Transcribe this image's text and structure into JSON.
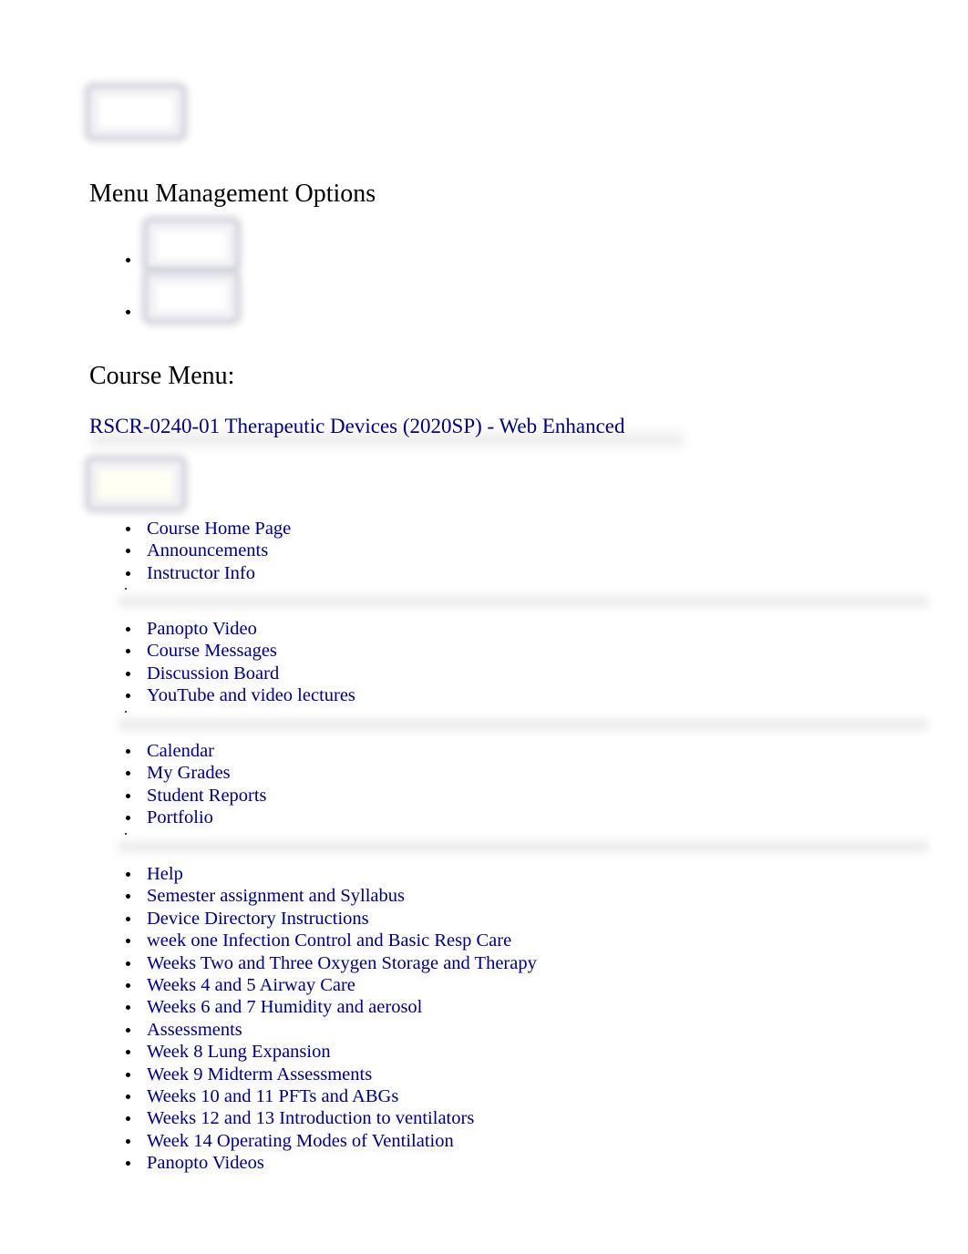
{
  "menu_management": {
    "title": "Menu Management Options",
    "items": [
      "",
      ""
    ]
  },
  "course_menu": {
    "title": "Course Menu:",
    "course_link": "RSCR-0240-01 Therapeutic Devices (2020SP) - Web Enhanced",
    "groups": [
      {
        "items": [
          "Course Home Page",
          "Announcements",
          "Instructor Info"
        ]
      },
      {
        "items": [
          "Panopto Video",
          "Course Messages",
          "Discussion Board",
          "YouTube and video lectures"
        ]
      },
      {
        "items": [
          "Calendar",
          "My Grades",
          "Student Reports",
          "Portfolio"
        ]
      },
      {
        "items": [
          "Help",
          "Semester assignment and Syllabus",
          "Device Directory Instructions",
          "week one Infection Control and Basic Resp Care",
          "Weeks Two and Three Oxygen Storage and Therapy",
          "Weeks 4 and 5 Airway Care",
          "Weeks 6 and 7 Humidity and aerosol",
          "Assessments",
          "Week 8 Lung Expansion",
          "Week 9 Midterm Assessments",
          "Weeks 10 and 11 PFTs and ABGs",
          "Weeks 12 and 13 Introduction to ventilators",
          "Week 14 Operating Modes of Ventilation",
          "Panopto Videos"
        ]
      }
    ]
  },
  "colors": {
    "link": "#000080",
    "text": "#000000",
    "background": "#ffffff"
  }
}
